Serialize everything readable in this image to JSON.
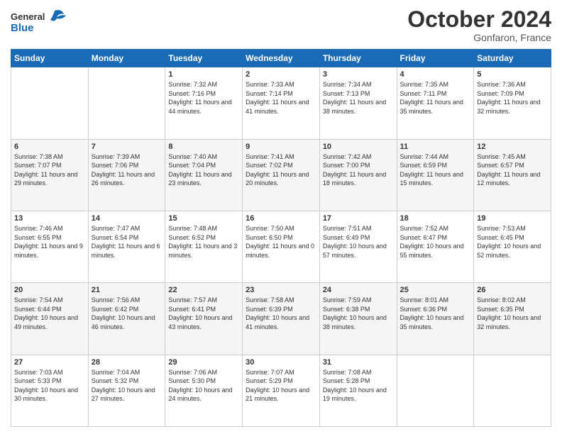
{
  "header": {
    "logo_line1": "General",
    "logo_line2": "Blue",
    "month": "October 2024",
    "location": "Gonfaron, France"
  },
  "days_of_week": [
    "Sunday",
    "Monday",
    "Tuesday",
    "Wednesday",
    "Thursday",
    "Friday",
    "Saturday"
  ],
  "weeks": [
    [
      {
        "day": "",
        "info": ""
      },
      {
        "day": "",
        "info": ""
      },
      {
        "day": "1",
        "info": "Sunrise: 7:32 AM\nSunset: 7:16 PM\nDaylight: 11 hours and 44 minutes."
      },
      {
        "day": "2",
        "info": "Sunrise: 7:33 AM\nSunset: 7:14 PM\nDaylight: 11 hours and 41 minutes."
      },
      {
        "day": "3",
        "info": "Sunrise: 7:34 AM\nSunset: 7:13 PM\nDaylight: 11 hours and 38 minutes."
      },
      {
        "day": "4",
        "info": "Sunrise: 7:35 AM\nSunset: 7:11 PM\nDaylight: 11 hours and 35 minutes."
      },
      {
        "day": "5",
        "info": "Sunrise: 7:36 AM\nSunset: 7:09 PM\nDaylight: 11 hours and 32 minutes."
      }
    ],
    [
      {
        "day": "6",
        "info": "Sunrise: 7:38 AM\nSunset: 7:07 PM\nDaylight: 11 hours and 29 minutes."
      },
      {
        "day": "7",
        "info": "Sunrise: 7:39 AM\nSunset: 7:06 PM\nDaylight: 11 hours and 26 minutes."
      },
      {
        "day": "8",
        "info": "Sunrise: 7:40 AM\nSunset: 7:04 PM\nDaylight: 11 hours and 23 minutes."
      },
      {
        "day": "9",
        "info": "Sunrise: 7:41 AM\nSunset: 7:02 PM\nDaylight: 11 hours and 20 minutes."
      },
      {
        "day": "10",
        "info": "Sunrise: 7:42 AM\nSunset: 7:00 PM\nDaylight: 11 hours and 18 minutes."
      },
      {
        "day": "11",
        "info": "Sunrise: 7:44 AM\nSunset: 6:59 PM\nDaylight: 11 hours and 15 minutes."
      },
      {
        "day": "12",
        "info": "Sunrise: 7:45 AM\nSunset: 6:57 PM\nDaylight: 11 hours and 12 minutes."
      }
    ],
    [
      {
        "day": "13",
        "info": "Sunrise: 7:46 AM\nSunset: 6:55 PM\nDaylight: 11 hours and 9 minutes."
      },
      {
        "day": "14",
        "info": "Sunrise: 7:47 AM\nSunset: 6:54 PM\nDaylight: 11 hours and 6 minutes."
      },
      {
        "day": "15",
        "info": "Sunrise: 7:48 AM\nSunset: 6:52 PM\nDaylight: 11 hours and 3 minutes."
      },
      {
        "day": "16",
        "info": "Sunrise: 7:50 AM\nSunset: 6:50 PM\nDaylight: 11 hours and 0 minutes."
      },
      {
        "day": "17",
        "info": "Sunrise: 7:51 AM\nSunset: 6:49 PM\nDaylight: 10 hours and 57 minutes."
      },
      {
        "day": "18",
        "info": "Sunrise: 7:52 AM\nSunset: 6:47 PM\nDaylight: 10 hours and 55 minutes."
      },
      {
        "day": "19",
        "info": "Sunrise: 7:53 AM\nSunset: 6:45 PM\nDaylight: 10 hours and 52 minutes."
      }
    ],
    [
      {
        "day": "20",
        "info": "Sunrise: 7:54 AM\nSunset: 6:44 PM\nDaylight: 10 hours and 49 minutes."
      },
      {
        "day": "21",
        "info": "Sunrise: 7:56 AM\nSunset: 6:42 PM\nDaylight: 10 hours and 46 minutes."
      },
      {
        "day": "22",
        "info": "Sunrise: 7:57 AM\nSunset: 6:41 PM\nDaylight: 10 hours and 43 minutes."
      },
      {
        "day": "23",
        "info": "Sunrise: 7:58 AM\nSunset: 6:39 PM\nDaylight: 10 hours and 41 minutes."
      },
      {
        "day": "24",
        "info": "Sunrise: 7:59 AM\nSunset: 6:38 PM\nDaylight: 10 hours and 38 minutes."
      },
      {
        "day": "25",
        "info": "Sunrise: 8:01 AM\nSunset: 6:36 PM\nDaylight: 10 hours and 35 minutes."
      },
      {
        "day": "26",
        "info": "Sunrise: 8:02 AM\nSunset: 6:35 PM\nDaylight: 10 hours and 32 minutes."
      }
    ],
    [
      {
        "day": "27",
        "info": "Sunrise: 7:03 AM\nSunset: 5:33 PM\nDaylight: 10 hours and 30 minutes."
      },
      {
        "day": "28",
        "info": "Sunrise: 7:04 AM\nSunset: 5:32 PM\nDaylight: 10 hours and 27 minutes."
      },
      {
        "day": "29",
        "info": "Sunrise: 7:06 AM\nSunset: 5:30 PM\nDaylight: 10 hours and 24 minutes."
      },
      {
        "day": "30",
        "info": "Sunrise: 7:07 AM\nSunset: 5:29 PM\nDaylight: 10 hours and 21 minutes."
      },
      {
        "day": "31",
        "info": "Sunrise: 7:08 AM\nSunset: 5:28 PM\nDaylight: 10 hours and 19 minutes."
      },
      {
        "day": "",
        "info": ""
      },
      {
        "day": "",
        "info": ""
      }
    ]
  ]
}
